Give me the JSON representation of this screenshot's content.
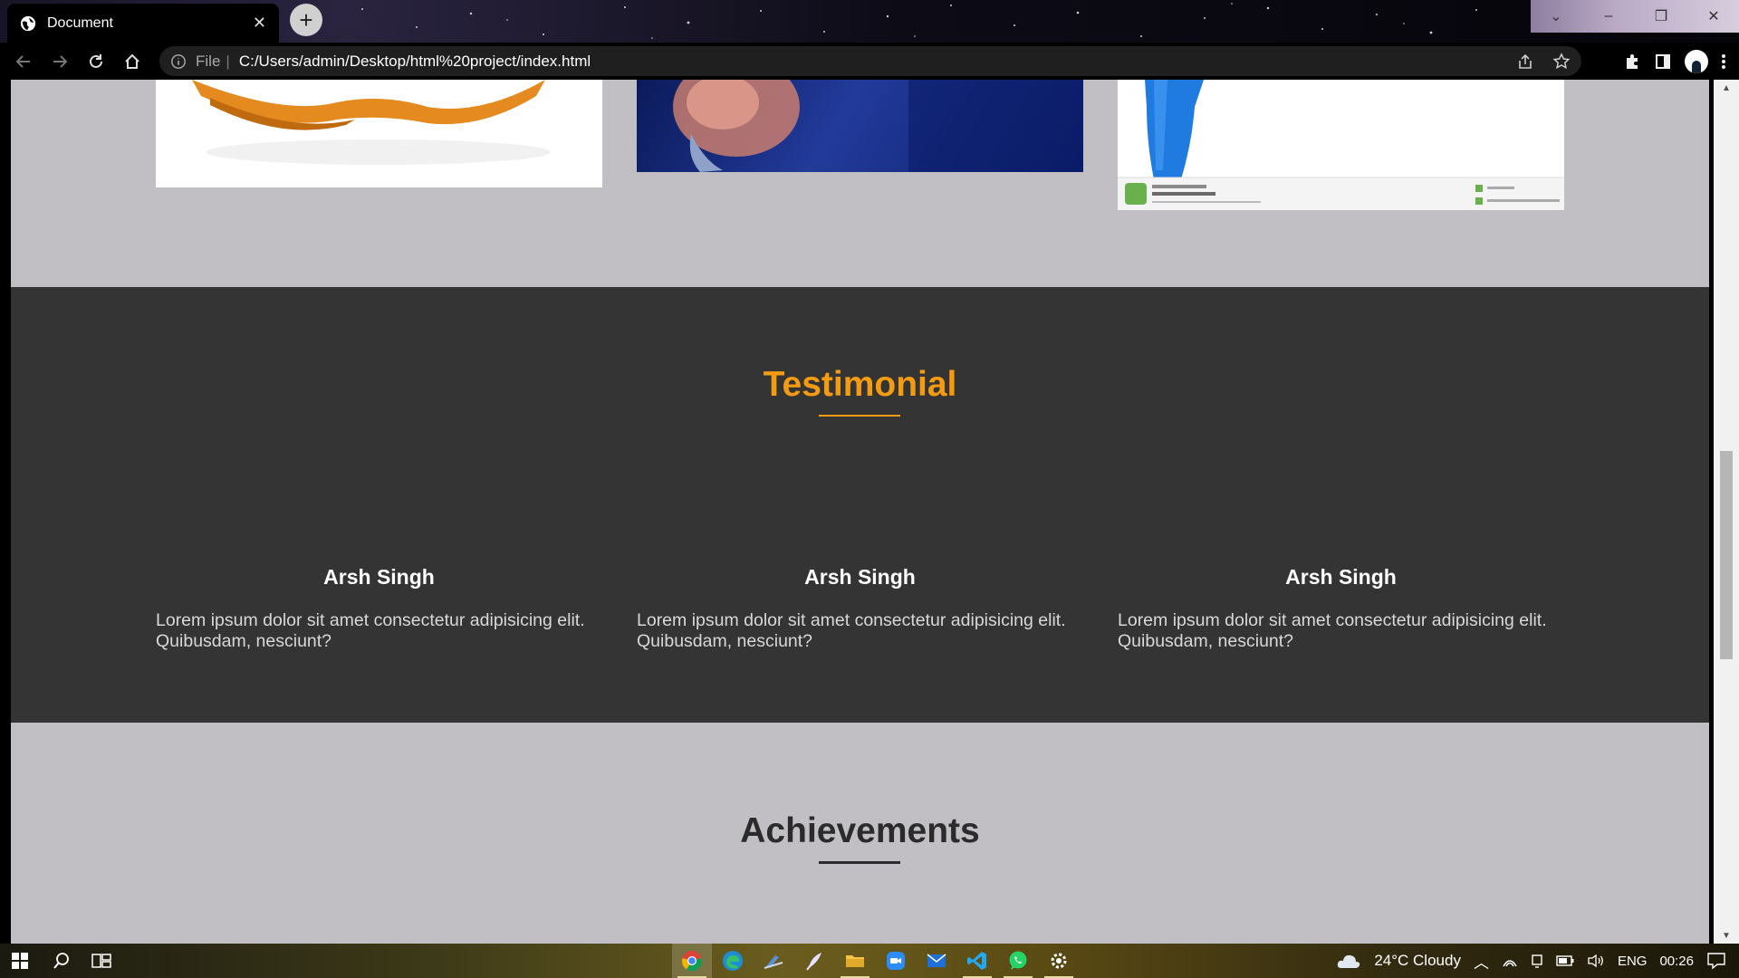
{
  "browser": {
    "tab_title": "Document",
    "address": {
      "scheme_label": "File",
      "url": "C:/Users/admin/Desktop/html%20project/index.html"
    }
  },
  "page": {
    "testimonial": {
      "heading": "Testimonial",
      "cards": [
        {
          "name": "Arsh Singh",
          "text": "Lorem ipsum dolor sit amet consectetur adipisicing elit. Quibusdam, nesciunt?"
        },
        {
          "name": "Arsh Singh",
          "text": "Lorem ipsum dolor sit amet consectetur adipisicing elit. Quibusdam, nesciunt?"
        },
        {
          "name": "Arsh Singh",
          "text": "Lorem ipsum dolor sit amet consectetur adipisicing elit. Quibusdam, nesciunt?"
        }
      ]
    },
    "achievements": {
      "heading": "Achievements"
    },
    "colors": {
      "accent": "#f39c12",
      "dark_section": "#343434",
      "light_section": "#c2bfc4"
    }
  },
  "taskbar": {
    "weather": "24°C  Cloudy",
    "language": "ENG",
    "time": "00:26",
    "apps": [
      "chrome-icon",
      "edge-icon",
      "python-icon",
      "pen-icon",
      "file-explorer-icon",
      "zoom-icon",
      "mail-icon",
      "vscode-icon",
      "whatsapp-icon",
      "settings-icon"
    ]
  }
}
